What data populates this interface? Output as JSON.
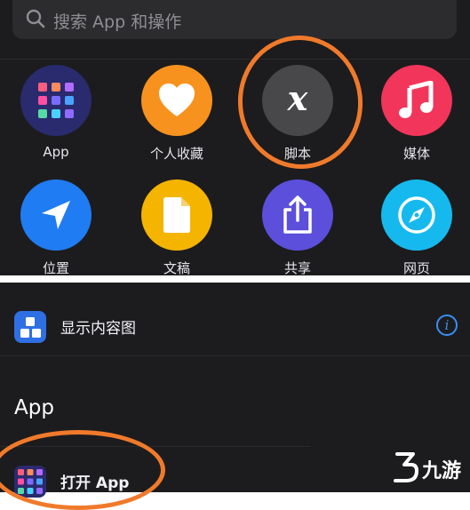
{
  "search": {
    "placeholder": "搜索 App 和操作"
  },
  "categories": [
    {
      "label": "App",
      "icon": "app-grid-icon",
      "color": "#2a2a6e"
    },
    {
      "label": "个人收藏",
      "icon": "heart-icon",
      "color": "#f7921e"
    },
    {
      "label": "脚本",
      "icon": "script-x-icon",
      "color": "#48484a"
    },
    {
      "label": "媒体",
      "icon": "music-note-icon",
      "color": "#f2355b"
    },
    {
      "label": "位置",
      "icon": "location-arrow-icon",
      "color": "#1f7cf2"
    },
    {
      "label": "文稿",
      "icon": "document-icon",
      "color": "#f5b400"
    },
    {
      "label": "共享",
      "icon": "share-icon",
      "color": "#5b4fdc"
    },
    {
      "label": "网页",
      "icon": "compass-icon",
      "color": "#16b9ee"
    }
  ],
  "action_row": {
    "label": "显示内容图",
    "icon": "shapes-icon",
    "info": "i"
  },
  "section": {
    "title": "App"
  },
  "app_row": {
    "label": "打开 App",
    "icon": "app-grid-icon"
  },
  "watermark": {
    "text": "九游"
  },
  "colors": {
    "highlight": "#f07a2b",
    "accent": "#3a8ef6",
    "background": "#1c1c1e"
  }
}
